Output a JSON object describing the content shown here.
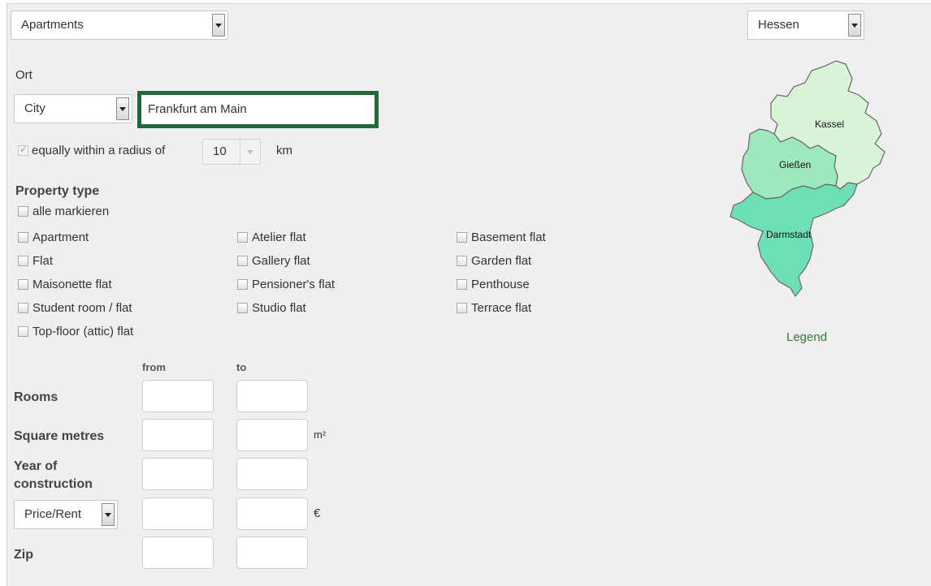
{
  "category_select": {
    "value": "Apartments"
  },
  "state_select": {
    "value": "Hessen"
  },
  "location": {
    "heading": "Ort",
    "type_value": "City",
    "city_value": "Frankfurt am Main",
    "radius_label": "equally within a radius of",
    "radius_value": "10",
    "radius_unit": "km"
  },
  "property_type": {
    "heading": "Property type",
    "select_all": "alle markieren",
    "columns": [
      [
        "Apartment",
        "Flat",
        "Maisonette flat",
        "Student room / flat",
        "Top-floor (attic) flat"
      ],
      [
        "Atelier flat",
        "Gallery flat",
        "Pensioner's flat",
        "Studio flat"
      ],
      [
        "Basement flat",
        "Garden flat",
        "Penthouse",
        "Terrace flat"
      ]
    ]
  },
  "ranges": {
    "from_label": "from",
    "to_label": "to",
    "rooms": "Rooms",
    "square_metres": "Square metres",
    "square_unit": "m²",
    "year_line1": "Year of",
    "year_line2": "construction",
    "price_select": "Price/Rent",
    "price_unit": "€",
    "zip": "Zip"
  },
  "map": {
    "regions": [
      "Kassel",
      "Gießen",
      "Darmstadt"
    ],
    "legend": "Legend",
    "colors": {
      "kassel": "#d8f5d8",
      "giessen": "#9ee8bd",
      "darmstadt": "#6fe0b6",
      "outline": "#666666",
      "legend": "#2f7d2f",
      "highlight": "#1f6b3a"
    }
  }
}
